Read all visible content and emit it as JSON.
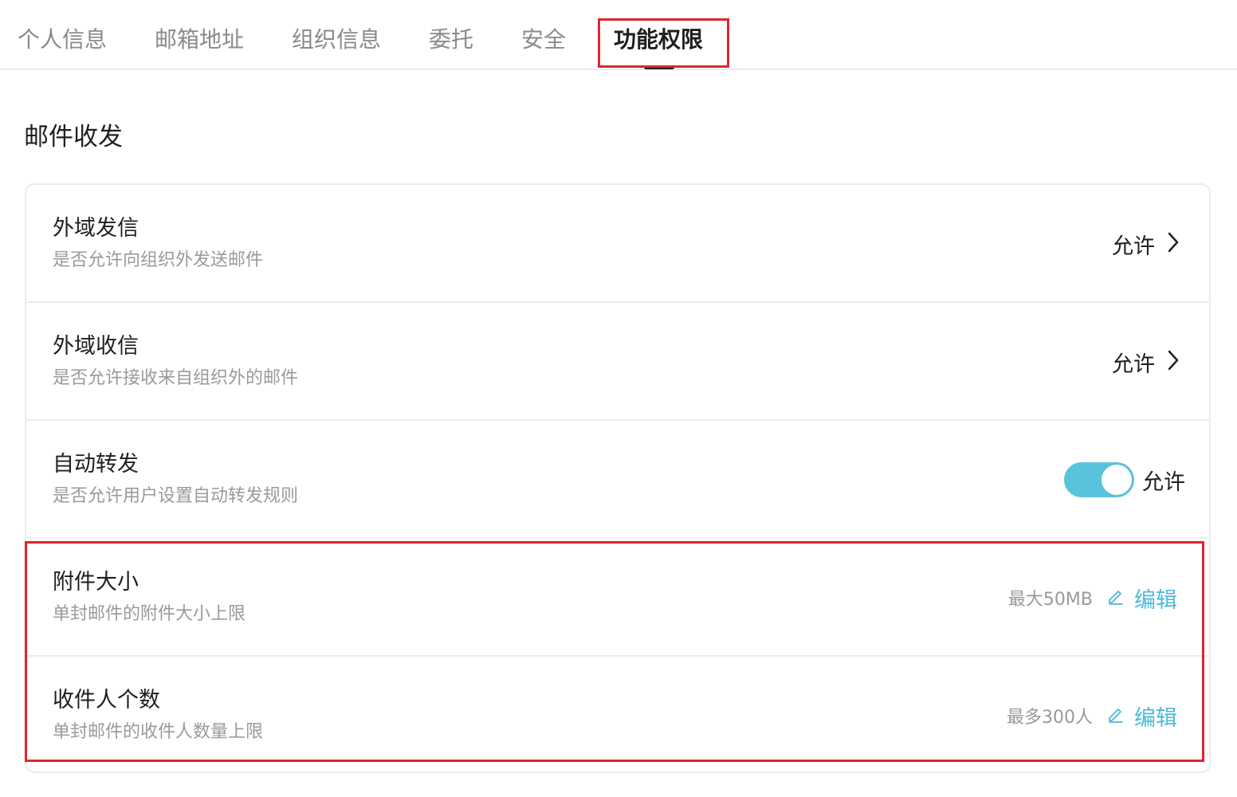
{
  "tabs": [
    {
      "label": "个人信息"
    },
    {
      "label": "邮箱地址"
    },
    {
      "label": "组织信息"
    },
    {
      "label": "委托"
    },
    {
      "label": "安全"
    },
    {
      "label": "功能权限",
      "active": true
    }
  ],
  "section": {
    "title": "邮件收发"
  },
  "settings": [
    {
      "title": "外域发信",
      "desc": "是否允许向组织外发送邮件",
      "value": "允许",
      "control": "chevron-right-icon"
    },
    {
      "title": "外域收信",
      "desc": "是否允许接收来自组织外的邮件",
      "value": "允许",
      "control": "chevron-right-icon"
    },
    {
      "title": "自动转发",
      "desc": "是否允许用户设置自动转发规则",
      "value": "允许",
      "control": "toggle",
      "toggle_on": true
    },
    {
      "title": "附件大小",
      "desc": "单封邮件的附件大小上限",
      "limit": "最大50MB",
      "action": "编辑",
      "control": "edit-icon"
    },
    {
      "title": "收件人个数",
      "desc": "单封邮件的收件人数量上限",
      "limit": "最多300人",
      "action": "编辑",
      "control": "edit-icon"
    }
  ],
  "colors": {
    "accent": "#4fb8d8",
    "toggle_on": "#5ac3dc",
    "highlight": "#e0242f",
    "muted_text": "#9a9a9a"
  }
}
